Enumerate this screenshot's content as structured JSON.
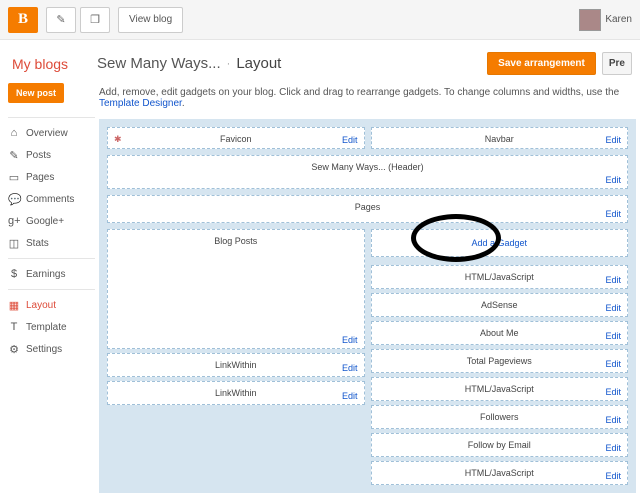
{
  "topbar": {
    "pencil": "✎",
    "docs": "❐",
    "view_blog": "View blog",
    "username": "Karen"
  },
  "header": {
    "my_blogs": "My blogs",
    "blog_title": "Sew Many Ways...",
    "section": "Layout",
    "save": "Save arrangement",
    "preview": "Pre"
  },
  "sidebar": {
    "new_post": "New post",
    "items": [
      {
        "icon": "⌂",
        "label": "Overview"
      },
      {
        "icon": "✎",
        "label": "Posts"
      },
      {
        "icon": "▭",
        "label": "Pages"
      },
      {
        "icon": "💬",
        "label": "Comments"
      },
      {
        "icon": "g+",
        "label": "Google+"
      },
      {
        "icon": "◫",
        "label": "Stats"
      },
      {
        "icon": "$",
        "label": "Earnings"
      },
      {
        "icon": "▦",
        "label": "Layout"
      },
      {
        "icon": "T",
        "label": "Template"
      },
      {
        "icon": "⚙",
        "label": "Settings"
      }
    ],
    "active_index": 7
  },
  "instructions": {
    "text_a": "Add, remove, edit gadgets on your blog. Click and drag to rearrange gadgets. To change columns and widths, use the ",
    "link": "Template Designer",
    "text_b": "."
  },
  "layout": {
    "favicon": "Favicon",
    "navbar": "Navbar",
    "header": "Sew Many Ways... (Header)",
    "pages": "Pages",
    "blog_posts": "Blog Posts",
    "linkwithin": "LinkWithin",
    "add_gadget": "Add a Gadget",
    "right_widgets": [
      "HTML/JavaScript",
      "AdSense",
      "About Me",
      "Total Pageviews",
      "HTML/JavaScript",
      "Followers",
      "Follow by Email",
      "HTML/JavaScript"
    ],
    "edit": "Edit"
  }
}
